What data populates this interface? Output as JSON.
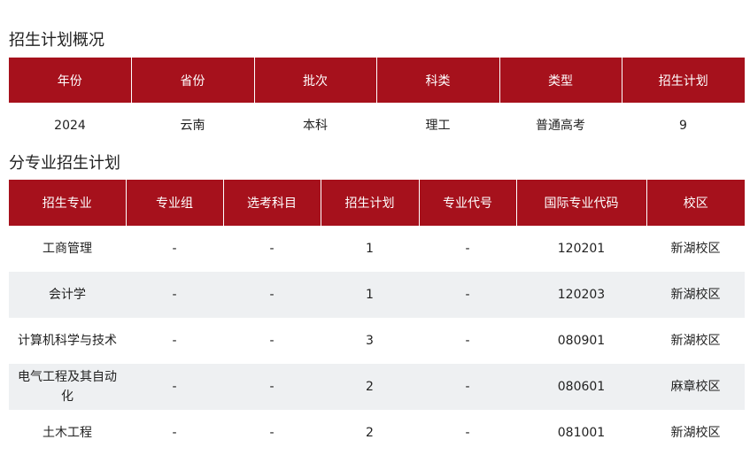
{
  "overview": {
    "title": "招生计划概况",
    "headers": [
      "年份",
      "省份",
      "批次",
      "科类",
      "类型",
      "招生计划"
    ],
    "row": [
      "2024",
      "云南",
      "本科",
      "理工",
      "普通高考",
      "9"
    ]
  },
  "majors": {
    "title": "分专业招生计划",
    "headers": [
      "招生专业",
      "专业组",
      "选考科目",
      "招生计划",
      "专业代号",
      "国际专业代码",
      "校区"
    ],
    "rows": [
      [
        "工商管理",
        "-",
        "-",
        "1",
        "-",
        "120201",
        "新湖校区"
      ],
      [
        "会计学",
        "-",
        "-",
        "1",
        "-",
        "120203",
        "新湖校区"
      ],
      [
        "计算机科学与技术",
        "-",
        "-",
        "3",
        "-",
        "080901",
        "新湖校区"
      ],
      [
        "电气工程及其自动化",
        "-",
        "-",
        "2",
        "-",
        "080601",
        "麻章校区"
      ],
      [
        "土木工程",
        "-",
        "-",
        "2",
        "-",
        "081001",
        "新湖校区"
      ]
    ]
  },
  "colors": {
    "header_bg": "#a6111c",
    "alt_row_bg": "#eef0f2"
  }
}
